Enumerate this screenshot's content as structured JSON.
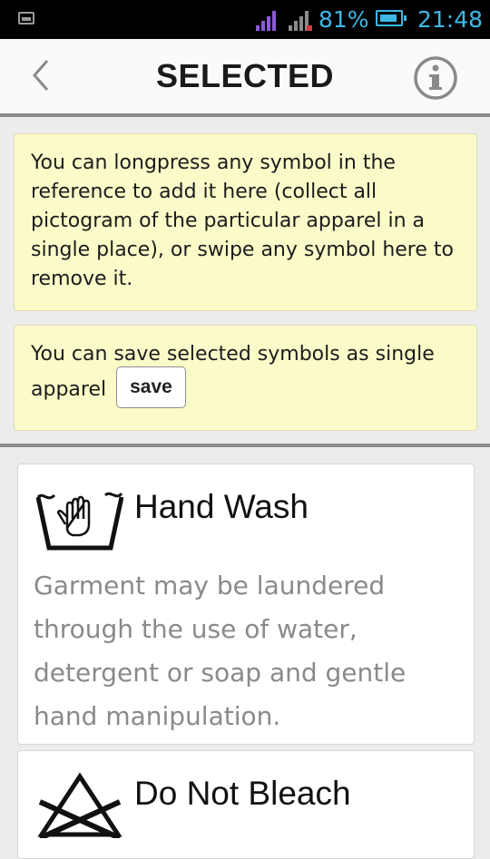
{
  "status_bar": {
    "battery_percent": "81%",
    "time": "21:48"
  },
  "header": {
    "title": "SELECTED",
    "back_icon": "chevron-left-icon",
    "info_icon": "info-icon"
  },
  "notes": {
    "longpress_text": "You can longpress any symbol in the reference to add it here (collect all pictogram of the particular apparel in a single place), or swipe any symbol here to remove it.",
    "save_text": "You can save selected symbols as single apparel",
    "save_label": "save"
  },
  "symbols": [
    {
      "icon": "hand-wash-icon",
      "title": "Hand Wash",
      "description": "Garment may be laundered through the use of water, detergent or soap and gentle hand manipulation."
    },
    {
      "icon": "do-not-bleach-icon",
      "title": "Do Not Bleach",
      "description": ""
    }
  ],
  "colors": {
    "status_text": "#3fb8e6",
    "note_background": "#fbfbc9",
    "description_text": "#8a8a8a"
  }
}
